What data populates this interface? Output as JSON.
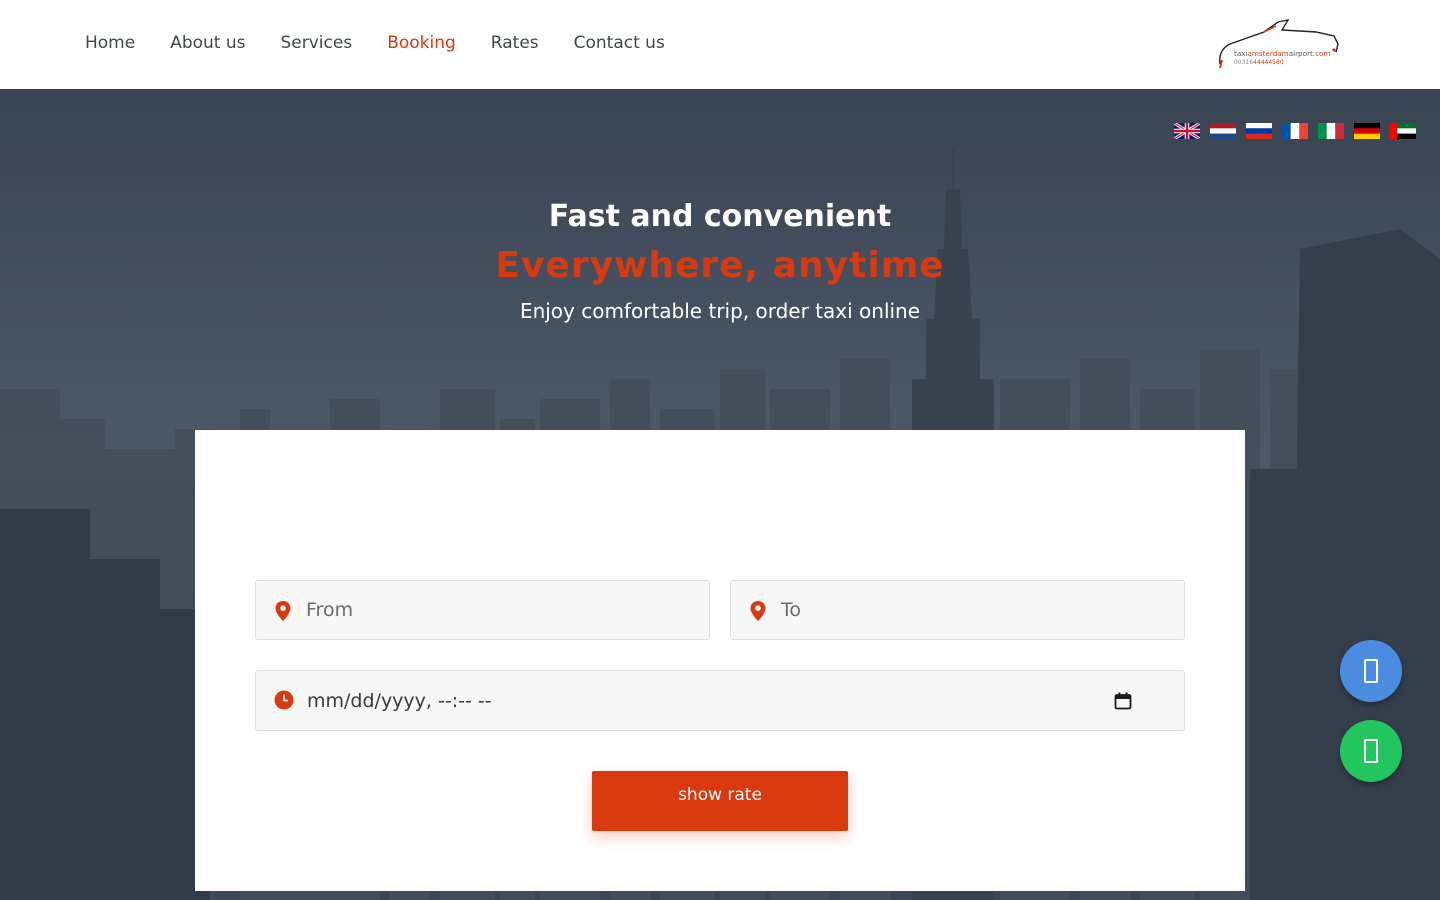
{
  "nav": {
    "items": [
      {
        "label": "Home",
        "active": false
      },
      {
        "label": "About us",
        "active": false
      },
      {
        "label": "Services",
        "active": false
      },
      {
        "label": "Booking",
        "active": true
      },
      {
        "label": "Rates",
        "active": false
      },
      {
        "label": "Contact us",
        "active": false
      }
    ],
    "active_color": "#d9390e"
  },
  "logo": {
    "brand_prefix": "taxi",
    "brand_highlight": "amsterdam",
    "brand_suffix": "airport",
    "brand_tld": ".com",
    "phone_prefix": "00316",
    "phone_suffix": "44444580"
  },
  "languages": [
    "english-flag",
    "dutch-flag",
    "russian-flag",
    "french-flag",
    "italian-flag",
    "german-flag",
    "uae-flag"
  ],
  "hero": {
    "title": "Fast and convenient",
    "subtitle": "Everywhere, anytime",
    "description": "Enjoy comfortable trip, order taxi online"
  },
  "form": {
    "from_placeholder": "From",
    "to_placeholder": "To",
    "date_placeholder": "mm/dd/yyyy, --:-- --",
    "submit_label": "show rate"
  },
  "floating": {
    "call_icon": "phone-icon",
    "whatsapp_icon": "whatsapp-icon",
    "call_color": "#4a8de0",
    "whatsapp_color": "#22c55e"
  },
  "colors": {
    "accent": "#d9390e",
    "hero_overlay": "#4a5566"
  }
}
